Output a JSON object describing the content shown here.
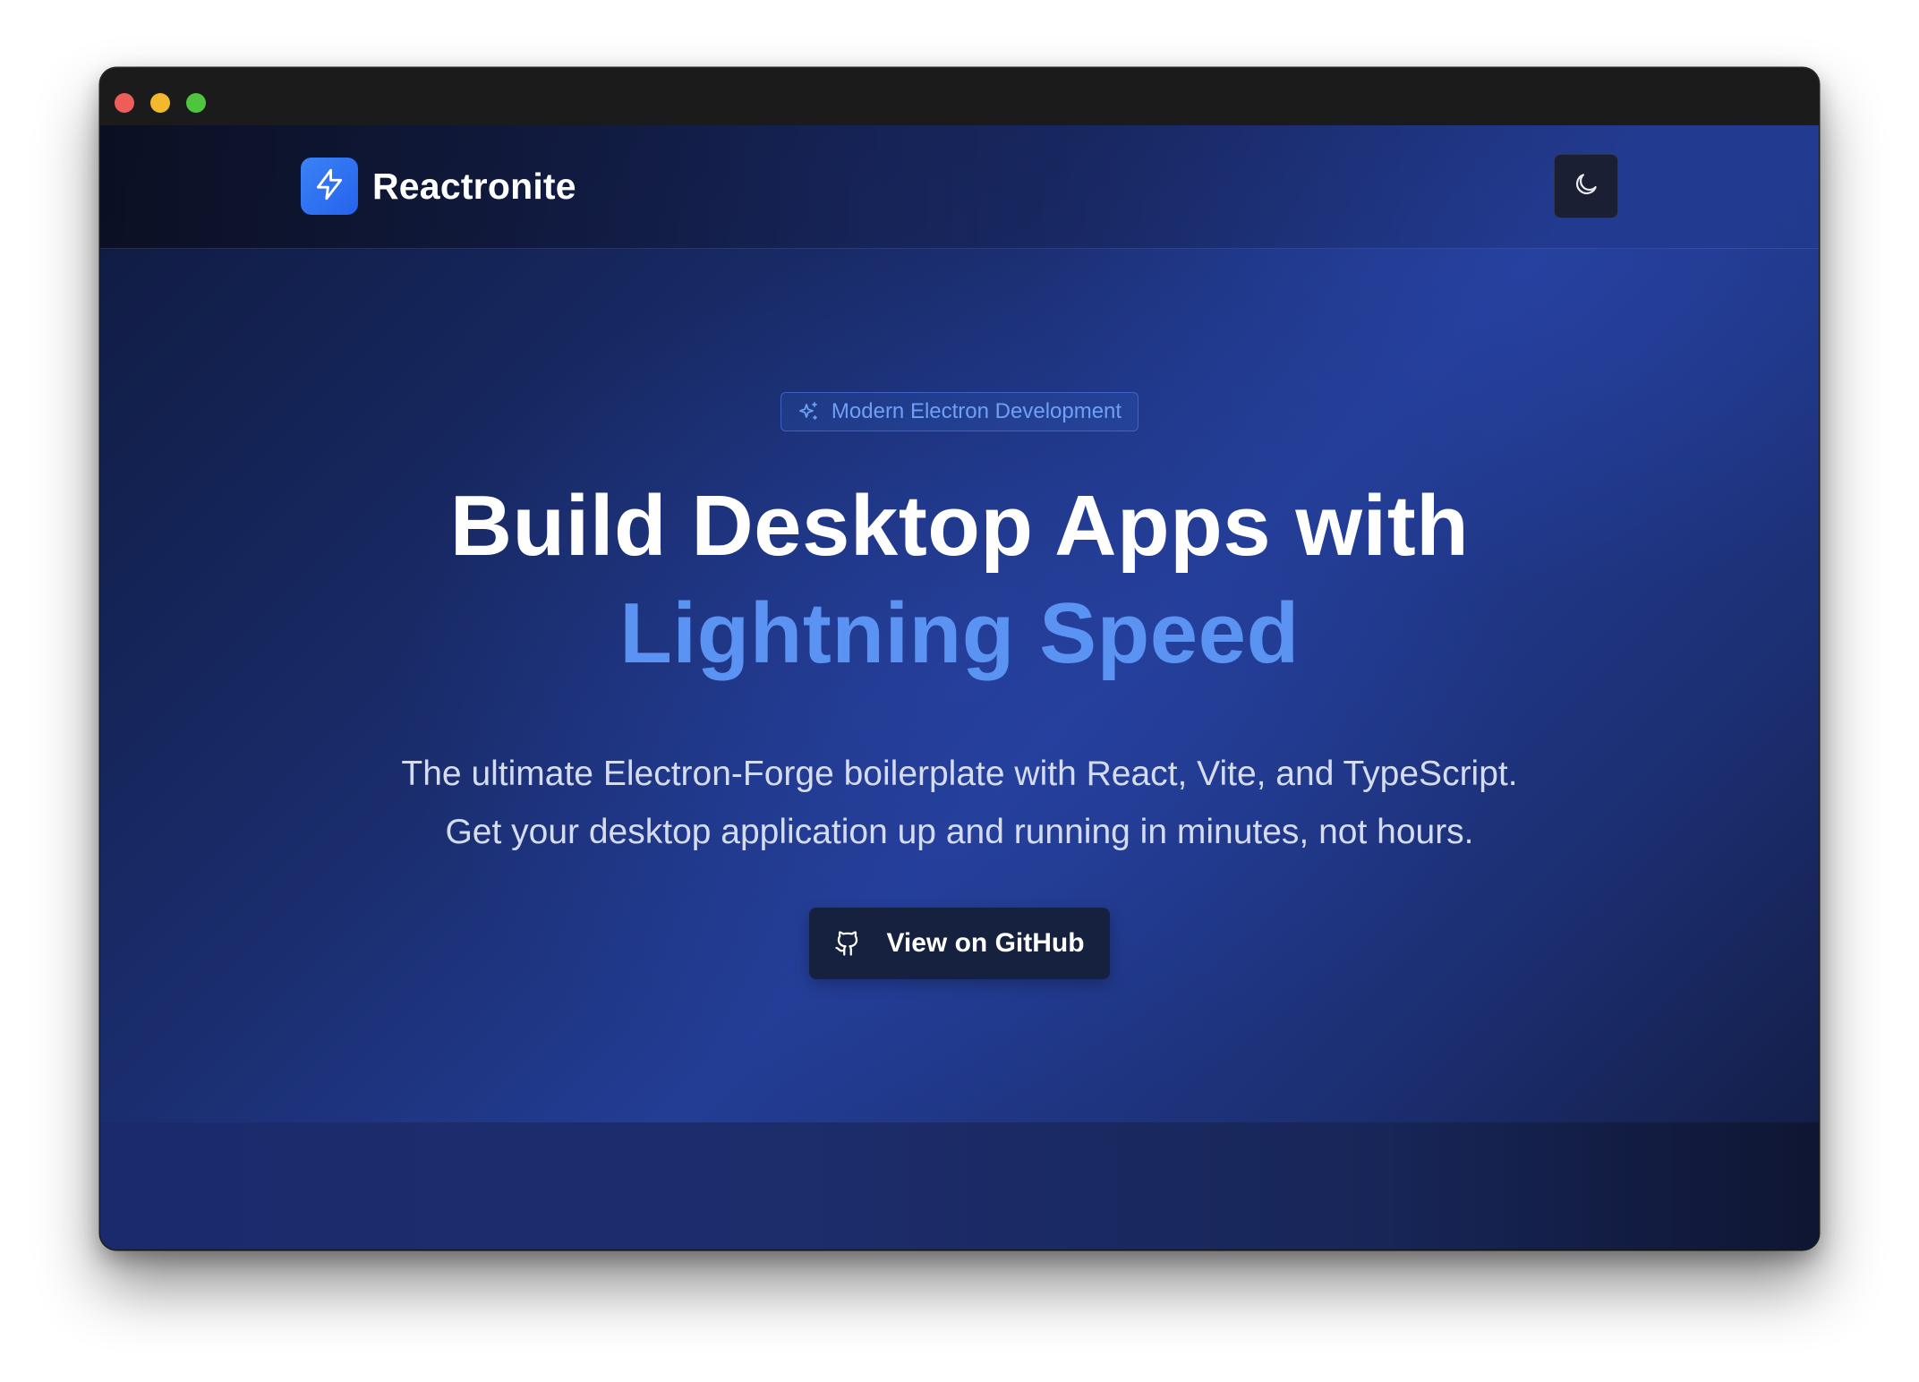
{
  "window": {
    "controls": [
      "close",
      "minimize",
      "maximize"
    ]
  },
  "header": {
    "logo_icon": "bolt-icon",
    "brand_name": "Reactronite",
    "theme_toggle_icon": "moon-icon"
  },
  "hero": {
    "badge": {
      "icon": "sparkles-icon",
      "label": "Modern Electron Development"
    },
    "headline_line1": "Build Desktop Apps with",
    "headline_line2": "Lightning Speed",
    "subtitle_line1": "The ultimate Electron-Forge boilerplate with React, Vite, and TypeScript.",
    "subtitle_line2": "Get your desktop application up and running in minutes, not hours.",
    "cta": {
      "icon": "github-icon",
      "label": "View on GitHub"
    }
  },
  "colors": {
    "accent": "#5b93f2",
    "logo_bg": "#3b82f6",
    "background": "#1a2d6e"
  }
}
